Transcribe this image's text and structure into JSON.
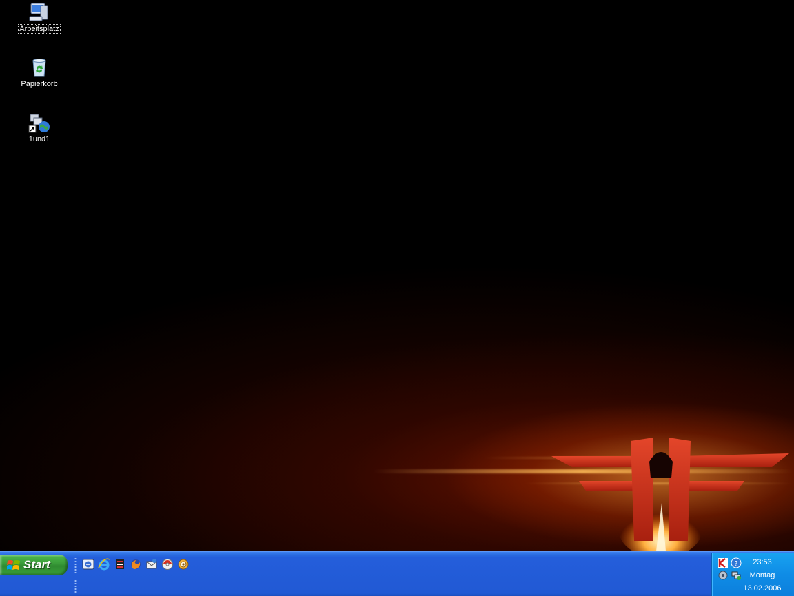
{
  "desktop": {
    "icons": [
      {
        "label": "Arbeitsplatz",
        "icon": "my-computer-icon",
        "selected": true
      },
      {
        "label": "Papierkorb",
        "icon": "recycle-bin-icon",
        "selected": false
      },
      {
        "label": "1und1",
        "icon": "network-shortcut-icon",
        "selected": false
      }
    ],
    "wallpaper": "orange-glow-emblem"
  },
  "taskbar": {
    "start_label": "Start",
    "quick_launch": [
      {
        "icon": "show-desktop-icon"
      },
      {
        "icon": "internet-explorer-icon"
      },
      {
        "icon": "media-player-icon"
      },
      {
        "icon": "firefox-icon"
      },
      {
        "icon": "email-client-icon"
      },
      {
        "icon": "media-disc-icon"
      },
      {
        "icon": "settings-gear-icon"
      }
    ],
    "tray": {
      "icons": [
        "kaspersky-icon",
        "help-icon",
        "volume-icon",
        "network-icon"
      ],
      "time": "23:53",
      "weekday": "Montag",
      "date": "13.02.2006"
    }
  },
  "colors": {
    "taskbar_blue": "#245edb",
    "start_green": "#3aa23a",
    "tray_blue": "#0f8ce6",
    "glow_orange": "#ff9a3a"
  }
}
